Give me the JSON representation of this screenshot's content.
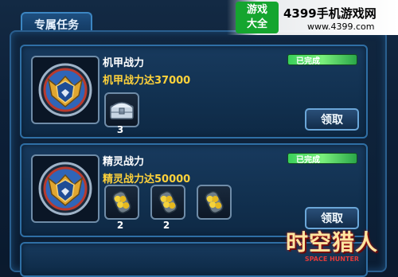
{
  "tab": {
    "label": "专属任务"
  },
  "tasks": [
    {
      "title": "机甲战力",
      "description": "机甲战力达37000",
      "status": "已完成",
      "claim_label": "领取",
      "rewards": [
        {
          "icon": "chest-icon",
          "count": "3"
        }
      ]
    },
    {
      "title": "精灵战力",
      "description": "精灵战力达50000",
      "status": "已完成",
      "claim_label": "领取",
      "rewards": [
        {
          "icon": "energy-capsule-icon",
          "count": "2"
        },
        {
          "icon": "energy-capsule-icon",
          "count": "2"
        },
        {
          "icon": "energy-capsule-icon",
          "count": ""
        }
      ]
    }
  ],
  "watermark": {
    "badge_line1": "游戏",
    "badge_line2": "大全",
    "site": "4399手机游戏网",
    "url": "www.4399.com"
  },
  "game_logo": {
    "main": "时空猎人",
    "sub": "SPACE HUNTER"
  },
  "colors": {
    "accent": "#2f6fa5",
    "gold_text": "#ffd23a",
    "status_green": "#3ad05a",
    "brand_green": "#15a52f"
  }
}
